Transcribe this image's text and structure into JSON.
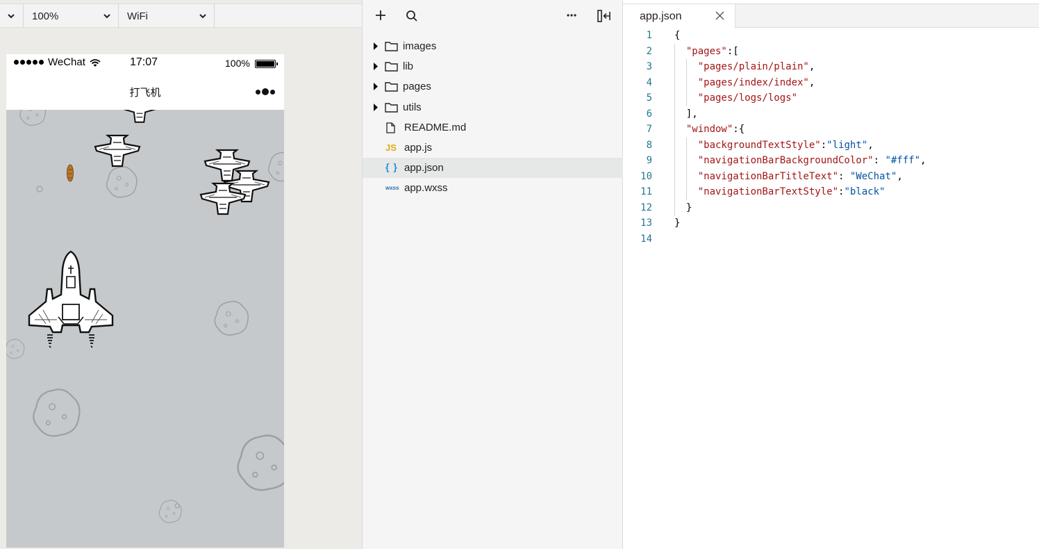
{
  "simulator": {
    "toolbar": {
      "zoom": "100%",
      "network": "WiFi"
    },
    "statusbar": {
      "carrier": "WeChat",
      "time": "17:07",
      "battery": "100%"
    },
    "navbar": {
      "title": "打飞机"
    }
  },
  "file_tree": {
    "items": [
      {
        "name": "images",
        "type": "folder"
      },
      {
        "name": "lib",
        "type": "folder"
      },
      {
        "name": "pages",
        "type": "folder"
      },
      {
        "name": "utils",
        "type": "folder"
      },
      {
        "name": "README.md",
        "type": "file"
      },
      {
        "name": "app.js",
        "type": "js",
        "badge": "JS"
      },
      {
        "name": "app.json",
        "type": "json",
        "badge": "{ }",
        "selected": true
      },
      {
        "name": "app.wxss",
        "type": "wxss",
        "badge": "wxss"
      }
    ]
  },
  "editor": {
    "tab": "app.json",
    "lines": [
      {
        "n": "1",
        "indent": 0,
        "parts": [
          [
            "p",
            "{"
          ]
        ]
      },
      {
        "n": "2",
        "indent": 1,
        "parts": [
          [
            "k",
            "\"pages\""
          ],
          [
            "p",
            ":["
          ]
        ]
      },
      {
        "n": "3",
        "indent": 2,
        "parts": [
          [
            "k",
            "\"pages/plain/plain\""
          ],
          [
            "p",
            ","
          ]
        ]
      },
      {
        "n": "4",
        "indent": 2,
        "parts": [
          [
            "k",
            "\"pages/index/index\""
          ],
          [
            "p",
            ","
          ]
        ]
      },
      {
        "n": "5",
        "indent": 2,
        "parts": [
          [
            "k",
            "\"pages/logs/logs\""
          ]
        ]
      },
      {
        "n": "6",
        "indent": 1,
        "parts": [
          [
            "p",
            "],"
          ]
        ]
      },
      {
        "n": "7",
        "indent": 1,
        "parts": [
          [
            "k",
            "\"window\""
          ],
          [
            "p",
            ":{"
          ]
        ]
      },
      {
        "n": "8",
        "indent": 2,
        "parts": [
          [
            "k",
            "\"backgroundTextStyle\""
          ],
          [
            "p",
            ":"
          ],
          [
            "v",
            "\"light\""
          ],
          [
            "p",
            ","
          ]
        ]
      },
      {
        "n": "9",
        "indent": 2,
        "parts": [
          [
            "k",
            "\"navigationBarBackgroundColor\""
          ],
          [
            "p",
            ": "
          ],
          [
            "v",
            "\"#fff\""
          ],
          [
            "p",
            ","
          ]
        ]
      },
      {
        "n": "10",
        "indent": 2,
        "parts": [
          [
            "k",
            "\"navigationBarTitleText\""
          ],
          [
            "p",
            ": "
          ],
          [
            "v",
            "\"WeChat\""
          ],
          [
            "p",
            ","
          ]
        ]
      },
      {
        "n": "11",
        "indent": 2,
        "parts": [
          [
            "k",
            "\"navigationBarTextStyle\""
          ],
          [
            "p",
            ":"
          ],
          [
            "v",
            "\"black\""
          ]
        ]
      },
      {
        "n": "12",
        "indent": 1,
        "parts": [
          [
            "p",
            "}"
          ]
        ]
      },
      {
        "n": "13",
        "indent": 0,
        "parts": [
          [
            "p",
            "}"
          ]
        ]
      },
      {
        "n": "14",
        "indent": 0,
        "parts": []
      }
    ]
  },
  "colors": {
    "json_key": "#a31515",
    "json_value": "#0451a5",
    "line_number": "#237893",
    "game_background": "#c5c9cc"
  },
  "icons": [
    "chevron-down-icon",
    "plus-icon",
    "search-icon",
    "more-icon",
    "collapse-panel-icon",
    "close-icon",
    "folder-icon",
    "file-icon",
    "wifi-icon",
    "battery-icon",
    "fighter-jet-icon",
    "enemy-plane-icon",
    "asteroid-icon",
    "bullet-icon"
  ]
}
